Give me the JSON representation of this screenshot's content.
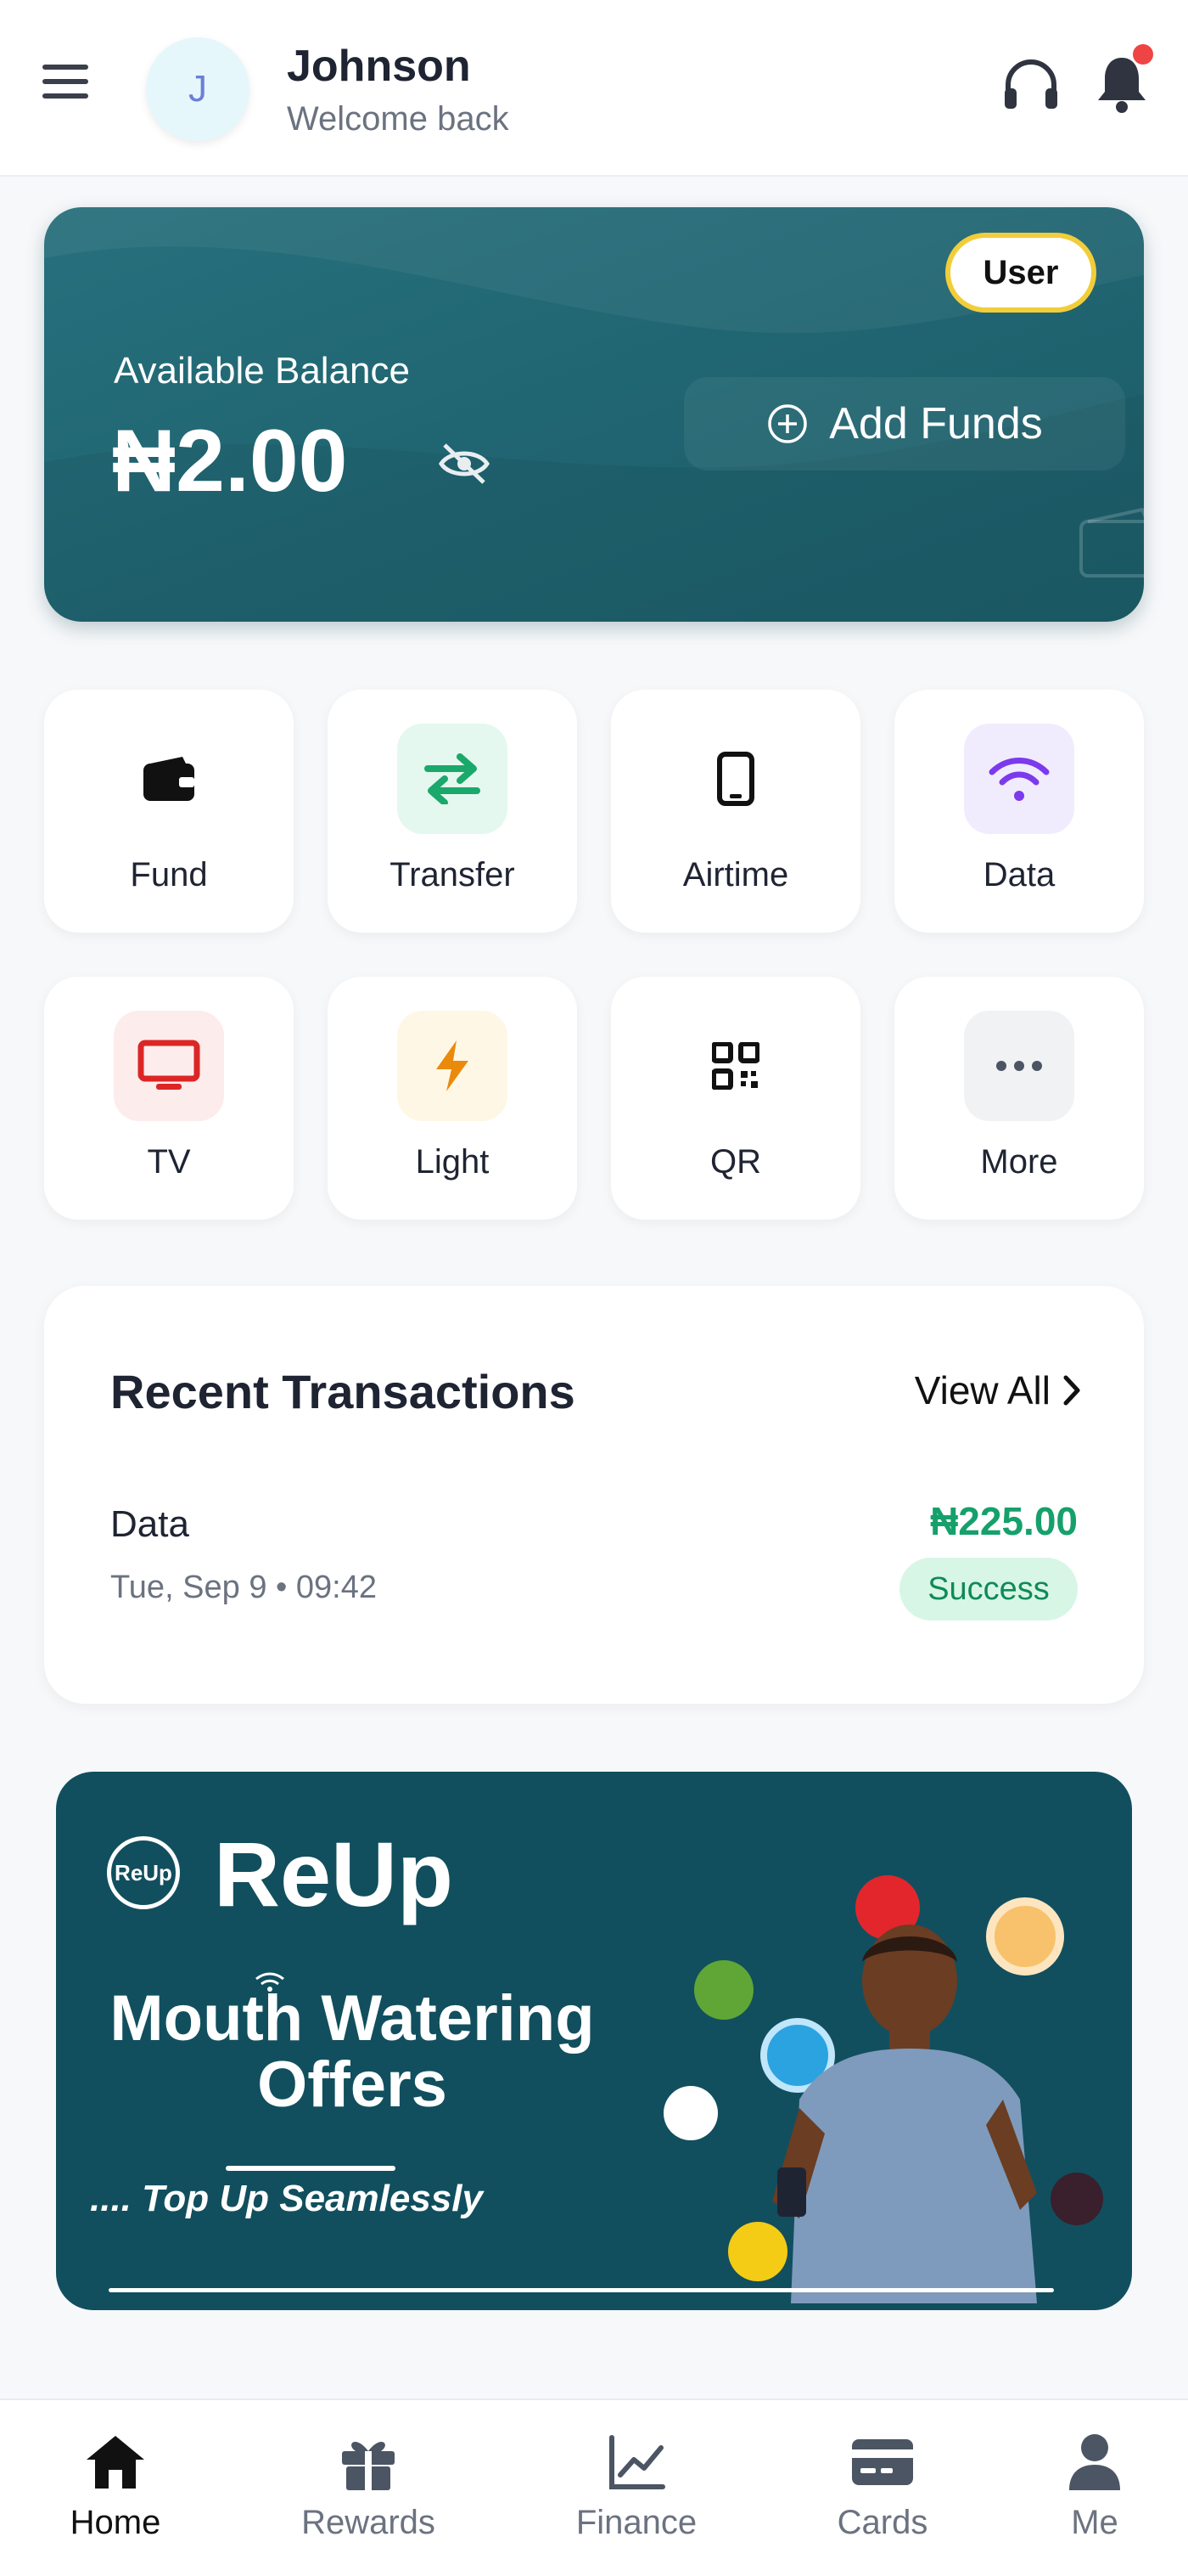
{
  "header": {
    "avatar_initial": "J",
    "user_name": "Johnson",
    "welcome_text": "Welcome back"
  },
  "balance": {
    "role_badge": "User",
    "label": "Available Balance",
    "amount": "₦2.00",
    "add_funds_label": "Add Funds"
  },
  "quick_actions": [
    {
      "label": "Fund",
      "icon": "wallet-icon"
    },
    {
      "label": "Transfer",
      "icon": "transfer-arrows-icon",
      "bg": "#e4f8ef",
      "color": "#1aa86b"
    },
    {
      "label": "Airtime",
      "icon": "phone-icon"
    },
    {
      "label": "Data",
      "icon": "wifi-icon",
      "bg": "#f1ecfd",
      "color": "#7c3aed"
    },
    {
      "label": "TV",
      "icon": "tv-icon",
      "bg": "#fdecec",
      "color": "#dc2626"
    },
    {
      "label": "Light",
      "icon": "lightning-icon",
      "bg": "#fff7e6",
      "color": "#ea8a0c"
    },
    {
      "label": "QR",
      "icon": "qr-code-icon"
    },
    {
      "label": "More",
      "icon": "more-dots-icon",
      "bg": "#f1f2f4",
      "color": "#4b5563"
    }
  ],
  "transactions": {
    "title": "Recent Transactions",
    "view_all_label": "View All",
    "items": [
      {
        "name": "Data",
        "date": "Tue, Sep 9 • 09:42",
        "amount": "₦225.00",
        "status": "Success"
      }
    ]
  },
  "promo": {
    "logo_text": "ReUp",
    "brand": "ReUp",
    "headline_line1": "Mouth Watering",
    "headline_line2": "Offers",
    "tagline": ".... Top Up Seamlessly"
  },
  "bottom_nav": [
    {
      "label": "Home",
      "icon": "home-icon",
      "active": true
    },
    {
      "label": "Rewards",
      "icon": "gift-icon"
    },
    {
      "label": "Finance",
      "icon": "chart-line-icon"
    },
    {
      "label": "Cards",
      "icon": "credit-card-icon"
    },
    {
      "label": "Me",
      "icon": "user-icon"
    }
  ],
  "colors": {
    "card_teal": "#1f6470",
    "promo_teal": "#114f5e",
    "success_green": "#16a06b",
    "badge_yellow": "#f2cd3a"
  }
}
